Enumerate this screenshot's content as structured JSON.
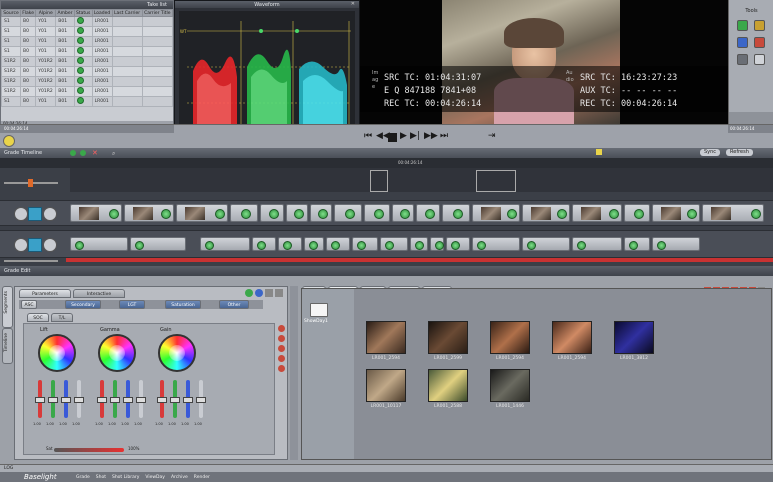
{
  "top_table": {
    "title": "Take list",
    "columns": [
      "Source",
      "Flake",
      "Alpine",
      "Amber",
      "Status",
      "Loaded",
      "Last Carrier",
      "Carrier Title"
    ],
    "rows": [
      {
        "source": "S1",
        "flake": "B0",
        "alpine": "Y01",
        "amber": "B01",
        "loaded": "LR001"
      },
      {
        "source": "S1",
        "flake": "B0",
        "alpine": "Y01",
        "amber": "B01",
        "loaded": "LR001"
      },
      {
        "source": "S1",
        "flake": "B0",
        "alpine": "Y01",
        "amber": "B01",
        "loaded": "LR001"
      },
      {
        "source": "S1",
        "flake": "B0",
        "alpine": "Y01",
        "amber": "B01",
        "loaded": "LR001"
      },
      {
        "source": "S1R2",
        "flake": "B0",
        "alpine": "Y01R2",
        "amber": "B01",
        "loaded": "LR001"
      },
      {
        "source": "S1R2",
        "flake": "B0",
        "alpine": "Y01R2",
        "amber": "B01",
        "loaded": "LR001"
      },
      {
        "source": "S1R2",
        "flake": "B0",
        "alpine": "Y01R2",
        "amber": "B01",
        "loaded": "LR001"
      },
      {
        "source": "S1R2",
        "flake": "B0",
        "alpine": "Y01R2",
        "amber": "B01",
        "loaded": "LR001"
      },
      {
        "source": "S1",
        "flake": "B0",
        "alpine": "Y01",
        "amber": "B01",
        "loaded": "LR001"
      }
    ],
    "footer_left": "00:04:26:14",
    "footer_right": "00:04:26:14"
  },
  "waveform": {
    "title": "Waveform",
    "scale_top": "WT",
    "scale_bottom": "BLK"
  },
  "video": {
    "src_label": "SRC TC:",
    "src_value": "01:04:31:07",
    "eq_label": "E Q",
    "eq_value": "847188 7841+08",
    "rec_label": "REC TC:",
    "rec_value": "00:04:26:14",
    "image_tag": "Image",
    "audio_tag": "Audio",
    "src2_label": "SRC TC:",
    "src2_value": "16:23:27:23",
    "aux_label": "AUX TC:",
    "aux_value": "-- -- -- --",
    "rec2_label": "REC TC:",
    "rec2_value": "00:04:26:14"
  },
  "tools": {
    "title": "Tools"
  },
  "timeline": {
    "title": "Grade Timeline",
    "timecode": "00:04:26:14",
    "sync_button": "Sync",
    "refresh_button": "Refresh"
  },
  "grade_edit": {
    "title": "Grade Edit",
    "side_tabs": [
      "Segments",
      "Timeline"
    ],
    "tabs": [
      "Parameters",
      "Interactive"
    ],
    "mode_tabs": [
      "ASC",
      "Secondary",
      "LGT",
      "Saturation",
      "Other"
    ],
    "sub_tabs": [
      "SOC",
      "T/L"
    ],
    "wheels": [
      "Lift",
      "Gamma",
      "Gain"
    ],
    "values": [
      "1.00",
      "1.00",
      "1.00",
      "1.00",
      "1.00",
      "1.00",
      "1.00",
      "1.00",
      "1.00",
      "1.00",
      "1.00",
      "1.00"
    ],
    "sat_label": "Sat",
    "sat_value": "100%"
  },
  "gallery": {
    "tabs": [
      "Shot Box",
      "Stills Store",
      "Presets",
      "Filmbrowser",
      "CCC Files"
    ],
    "folder_label": "ShowDay1",
    "items": [
      {
        "label": "LR001_2594"
      },
      {
        "label": "LR001_2599"
      },
      {
        "label": "LR001_2594"
      },
      {
        "label": "LR001_2594"
      },
      {
        "label": "LR001_3812"
      },
      {
        "label": "LR001_10117"
      },
      {
        "label": "LR001_2588"
      },
      {
        "label": "LR001_1446"
      }
    ]
  },
  "status": {
    "text": "LOG"
  },
  "taskbar": {
    "brand": "Baselight",
    "items": [
      "Grade",
      "Shot",
      "Shot Library",
      "ViewDay",
      "Archive",
      "Render"
    ]
  }
}
